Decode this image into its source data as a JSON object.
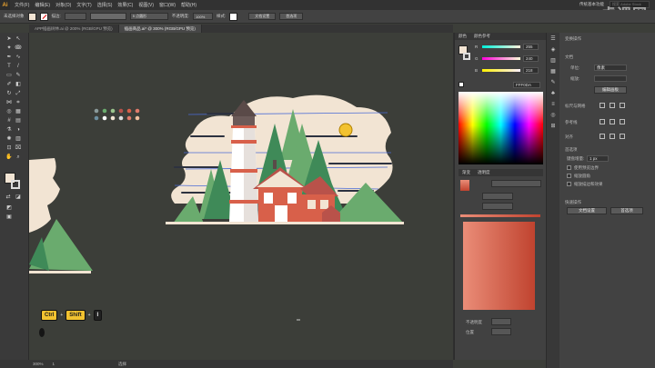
{
  "app": {
    "logo": "Ai",
    "watermark": "虎课网",
    "search_placeholder": "搜索 Adobe Stock",
    "workspace": "传统基本功能"
  },
  "menu": [
    "文件(F)",
    "编辑(E)",
    "对象(O)",
    "文字(T)",
    "选择(S)",
    "效果(C)",
    "视图(V)",
    "窗口(W)",
    "帮助(H)"
  ],
  "control": {
    "selection": "未选择对象",
    "stroke_label": "描边:",
    "opacity_label": "不透明度:",
    "style_label": "样式:",
    "brush_label": "5 点圆形",
    "opacity_value": "100%",
    "doc_setup": "文档设置",
    "prefs": "首选项"
  },
  "tabs": [
    {
      "label": "APP插画树林.ai @ 200% (RGB/GPU 预览)",
      "active": false
    },
    {
      "label": "插画商品.ai* @ 300% (RGB/GPU 预览)",
      "active": true
    }
  ],
  "status": {
    "zoom": "300%",
    "page": "1",
    "tool": "选择"
  },
  "shortcut": {
    "key1": "Ctrl",
    "key2": "Shift",
    "key3": "I"
  },
  "color_panel": {
    "title": "颜色",
    "title2": "颜色参考",
    "r_label": "R",
    "g_label": "G",
    "b_label": "B",
    "r": "255",
    "g": "240",
    "b": "218",
    "hex": "FFF0DA"
  },
  "gradient_panel": {
    "tab1": "渐变",
    "tab2": "透明度",
    "opacity_label": "不透明度",
    "location_label": "位置"
  },
  "properties": {
    "title": "变换操作",
    "unit_label": "单位:",
    "unit_value": "像素",
    "snap_label": "缩放:",
    "edit_artboard": "编辑画板",
    "guides_label": "参考线",
    "align_label": "对齐",
    "nudge_label": "键盘增量:",
    "nudge_value": "1 px",
    "chk1": "使用预览边界",
    "chk2": "缩放圆角",
    "chk3": "缩放描边和效果",
    "quick_label": "快速操作",
    "doc_setup_btn": "文档设置",
    "prefs_btn": "首选项",
    "ruler_label": "标尺与网格",
    "section": "文档"
  },
  "colors": {
    "sky": "#f2e4d3",
    "brick": "#d8604a",
    "tree": "#6aab6e",
    "tree_dark": "#3f8a58",
    "sun": "#f2c230",
    "accent": "#f2c230"
  },
  "palette": [
    "#8a9a9a",
    "#6aab6e",
    "#d8604a",
    "#b9524a",
    "#e07a6a",
    "#c8a0a0",
    "#6d8fa0",
    "#ffffff",
    "#f2e4d3",
    "#ddd",
    "#e07a6a",
    "#f0c0a0"
  ]
}
